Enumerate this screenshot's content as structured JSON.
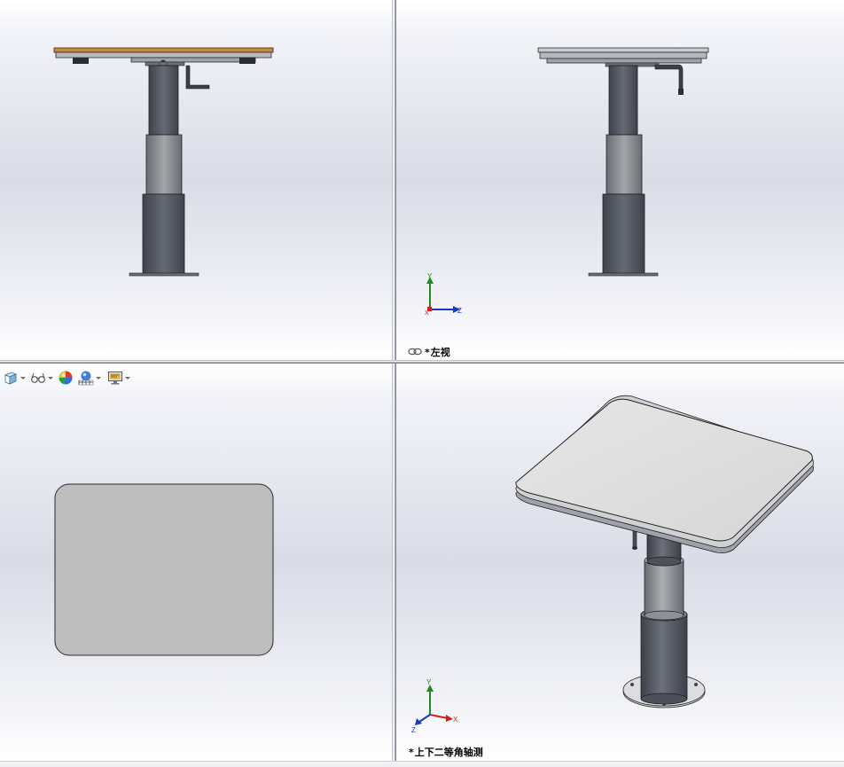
{
  "app": "SolidWorks",
  "viewports": {
    "front": {
      "name": ""
    },
    "left": {
      "name": "左视",
      "modified_marker": "*",
      "linked": true
    },
    "top": {
      "name": ""
    },
    "iso": {
      "name": "上下二等角轴测",
      "modified_marker": "*"
    }
  },
  "triad": {
    "y": "Y",
    "z": "Z",
    "x": "X"
  },
  "heads_up_toolbar": [
    {
      "icon": "view-orientation-cube-icon",
      "dropdown": true
    },
    {
      "icon": "display-style-glasses-icon",
      "dropdown": true
    },
    {
      "icon": "appearance-color-ball-icon",
      "dropdown": false
    },
    {
      "icon": "scene-icon",
      "dropdown": true
    },
    {
      "icon": "view-settings-monitor-icon",
      "dropdown": true
    }
  ],
  "colors": {
    "viewport_background": "#d9dbe6",
    "tabletop_edge_wood": "#c98a3c",
    "column_dark": "#585c66",
    "column_mid": "#8b8d92",
    "top_view_plate": "#bdbdbd",
    "triad_y": "#1f8a1f",
    "triad_z": "#1538c9",
    "triad_x": "#d11f1f"
  }
}
